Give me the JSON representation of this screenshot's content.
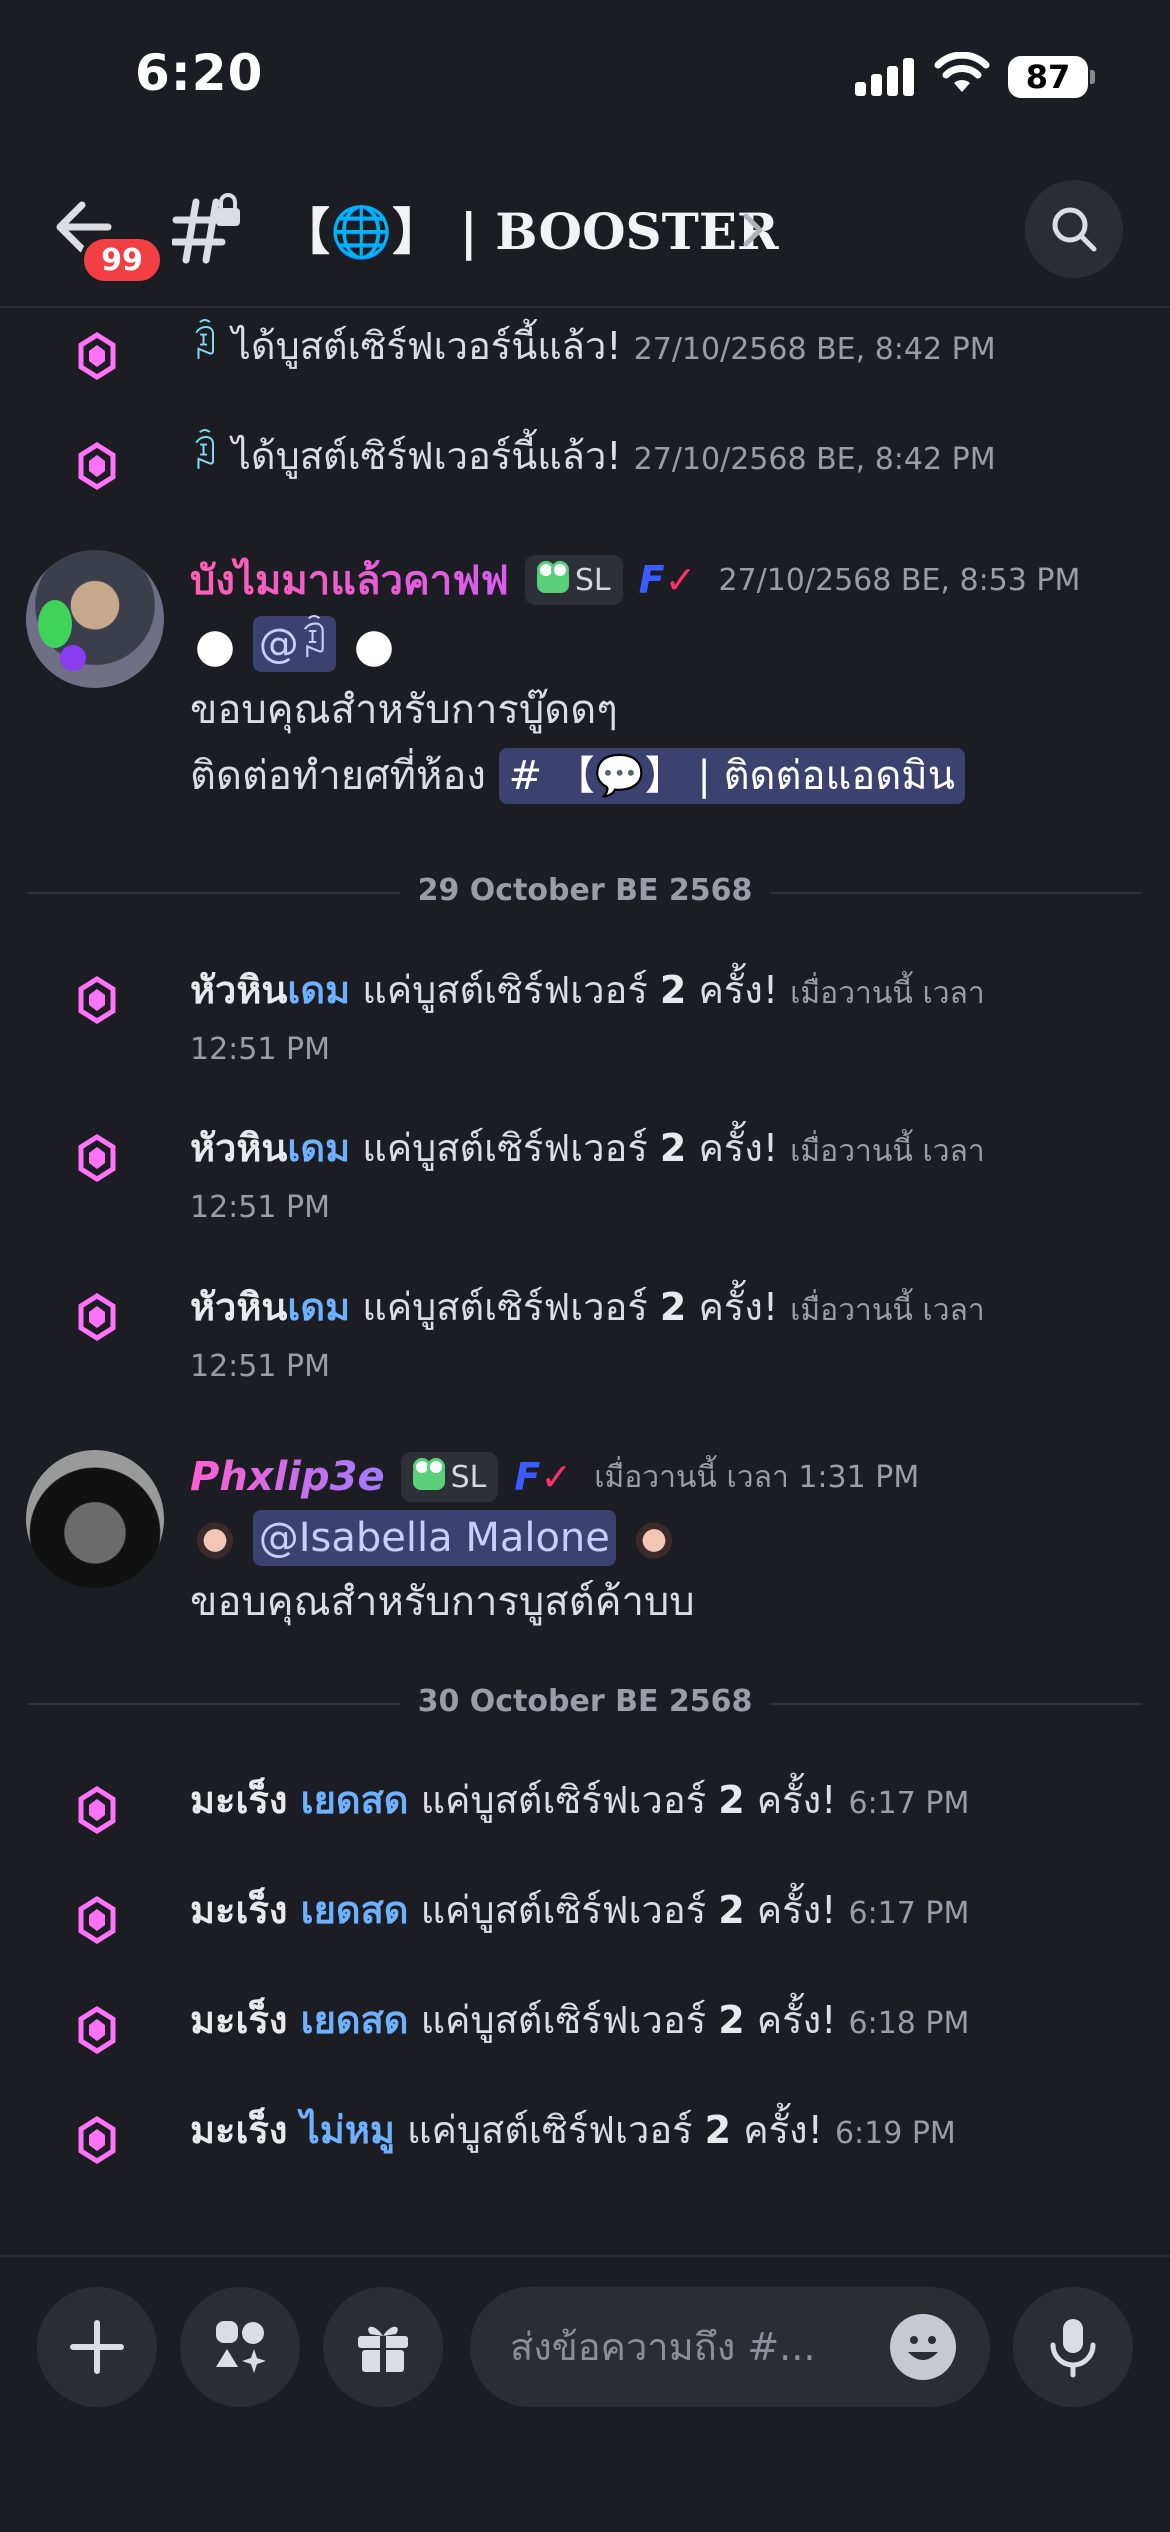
{
  "status": {
    "time": "6:20",
    "battery": "87"
  },
  "header": {
    "badge": "99",
    "title": "【🌐】 | BOOSTER"
  },
  "messages": {
    "boost1": {
      "user": "ꀢ",
      "text": "ได้บูสต์เซิร์ฟเวอร์นี้แล้ว!",
      "time": "27/10/2568 BE, 8:42 PM"
    },
    "boost2": {
      "user": "ꀢ",
      "text": "ได้บูสต์เซิร์ฟเวอร์นี้แล้ว!",
      "time": "27/10/2568 BE, 8:42 PM"
    },
    "msg1": {
      "author": "บังไมมาแล้วคาฟฟ",
      "tag": "SL",
      "time": "27/10/2568 BE, 8:53 PM",
      "mention": "@ꀢ",
      "line2": "ขอบคุณสำหรับการบู๊ดดๆ",
      "line3_prefix": "ติดต่อทำยศที่ห้อง",
      "channel_link": "# 【💬】 | ติดต่อแอดมิน"
    },
    "divider1": "29 October BE 2568",
    "boost3": {
      "name_a": "หัวหิน",
      "name_b": "เดม",
      "text": "แค่บูสต์เซิร์ฟเวอร์",
      "count": "2",
      "suffix": "ครั้ง!",
      "time1": "เมื่อวานนี้ เวลา",
      "time2": "12:51 PM"
    },
    "boost4": {
      "name_a": "หัวหิน",
      "name_b": "เดม",
      "text": "แค่บูสต์เซิร์ฟเวอร์",
      "count": "2",
      "suffix": "ครั้ง!",
      "time1": "เมื่อวานนี้ เวลา",
      "time2": "12:51 PM"
    },
    "boost5": {
      "name_a": "หัวหิน",
      "name_b": "เดม",
      "text": "แค่บูสต์เซิร์ฟเวอร์",
      "count": "2",
      "suffix": "ครั้ง!",
      "time1": "เมื่อวานนี้ เวลา",
      "time2": "12:51 PM"
    },
    "msg2": {
      "author": "Phxlip3e",
      "tag": "SL",
      "time": "เมื่อวานนี้ เวลา 1:31 PM",
      "mention": "@Isabella Malone",
      "line2": "ขอบคุณสำหรับการบูสต์ค้าบบ"
    },
    "divider2": "30 October BE 2568",
    "boost6": {
      "name_a": "มะเร็ง",
      "name_b": "เยดสด",
      "text": "แค่บูสต์เซิร์ฟเวอร์",
      "count": "2",
      "suffix": "ครั้ง!",
      "time": "6:17 PM"
    },
    "boost7": {
      "name_a": "มะเร็ง",
      "name_b": "เยดสด",
      "text": "แค่บูสต์เซิร์ฟเวอร์",
      "count": "2",
      "suffix": "ครั้ง!",
      "time": "6:17 PM"
    },
    "boost8": {
      "name_a": "มะเร็ง",
      "name_b": "เยดสด",
      "text": "แค่บูสต์เซิร์ฟเวอร์",
      "count": "2",
      "suffix": "ครั้ง!",
      "time": "6:18 PM"
    },
    "boost9": {
      "name_a": "มะเร็ง",
      "name_b": "ไม่หมู",
      "text": "แค่บูสต์เซิร์ฟเวอร์",
      "count": "2",
      "suffix": "ครั้ง!",
      "time": "6:19 PM"
    }
  },
  "composer": {
    "placeholder": "ส่งข้อความถึง #..."
  },
  "colors": {
    "background": "#1c1d23",
    "boost_pink": "#ff73fa",
    "mention_bg": "#3c4270",
    "link_blue": "#6eb1ff"
  }
}
